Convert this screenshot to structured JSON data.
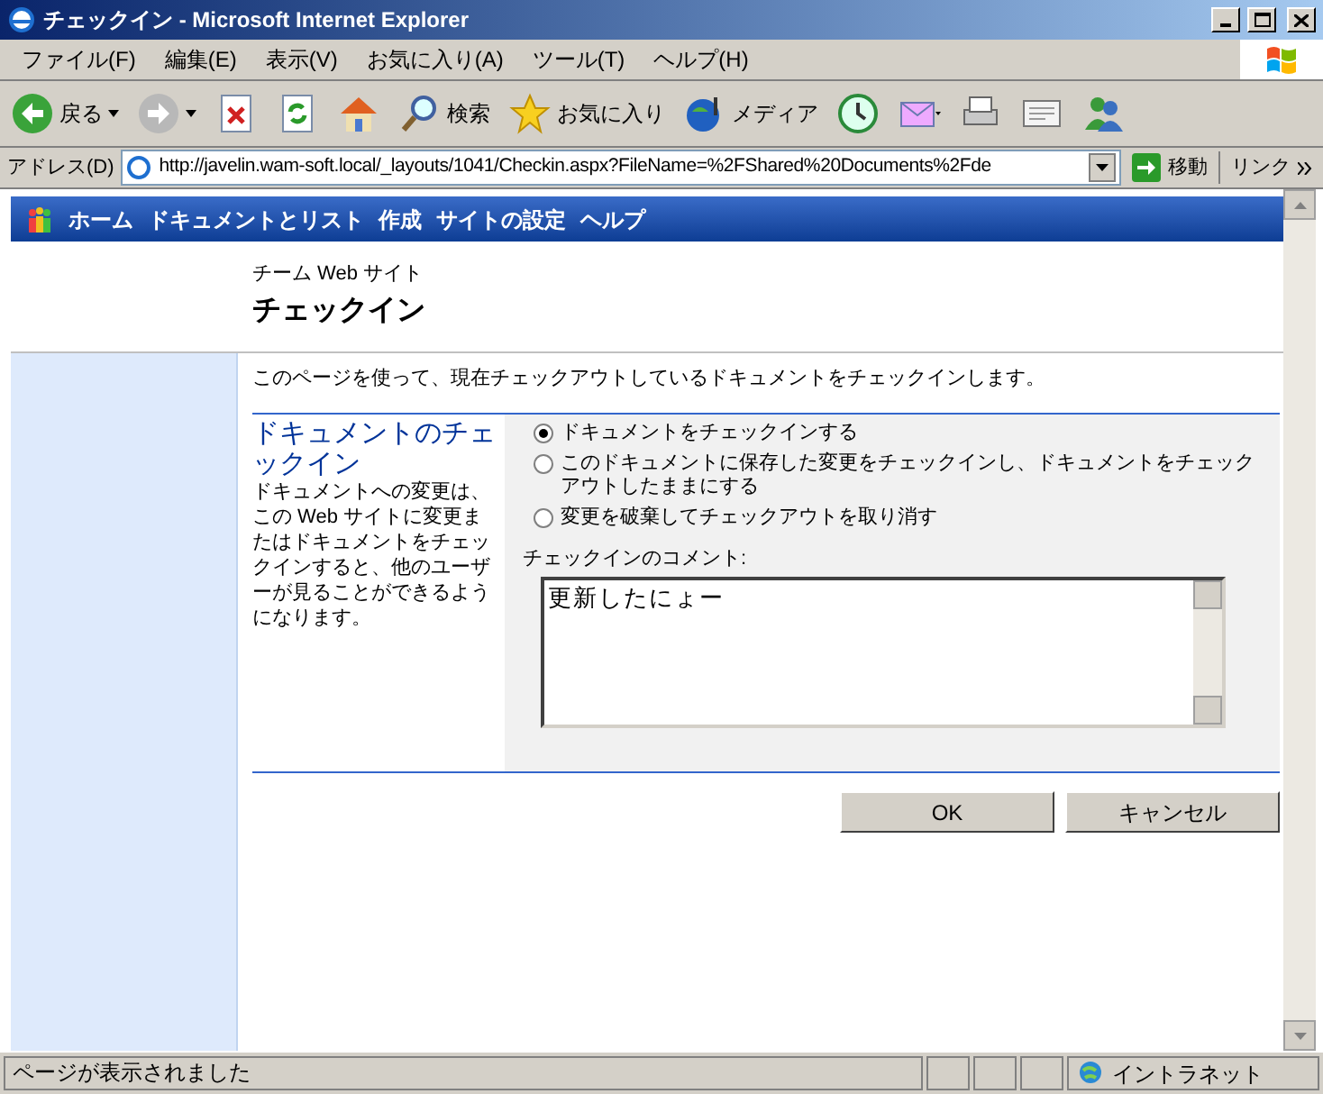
{
  "window": {
    "title": "チェックイン - Microsoft Internet Explorer"
  },
  "menu": [
    "ファイル(F)",
    "編集(E)",
    "表示(V)",
    "お気に入り(A)",
    "ツール(T)",
    "ヘルプ(H)"
  ],
  "toolbar": [
    {
      "kind": "back",
      "label": "戻る"
    },
    {
      "kind": "forward"
    },
    {
      "kind": "stop"
    },
    {
      "kind": "refresh"
    },
    {
      "kind": "home"
    },
    {
      "kind": "search",
      "label": "検索"
    },
    {
      "kind": "favorites",
      "label": "お気に入り"
    },
    {
      "kind": "media",
      "label": "メディア"
    },
    {
      "kind": "history"
    },
    {
      "kind": "mail"
    },
    {
      "kind": "print"
    },
    {
      "kind": "edit"
    },
    {
      "kind": "messenger"
    }
  ],
  "address": {
    "label": "アドレス(D)",
    "value": "http://javelin.wam-soft.local/_layouts/1041/Checkin.aspx?FileName=%2FShared%20Documents%2Fde",
    "go": "移動",
    "links": "リンク"
  },
  "site_nav": [
    "ホーム",
    "ドキュメントとリスト",
    "作成",
    "サイトの設定",
    "ヘルプ"
  ],
  "header": {
    "site": "チーム Web サイト",
    "title": "チェックイン"
  },
  "description": "このページを使って、現在チェックアウトしているドキュメントをチェックインします。",
  "section": {
    "title": "ドキュメントのチェックイン",
    "text": "ドキュメントへの変更は、この Web サイトに変更またはドキュメントをチェックインすると、他のユーザーが見ることができるようになります。"
  },
  "options": [
    {
      "label": "ドキュメントをチェックインする",
      "selected": true
    },
    {
      "label": "このドキュメントに保存した変更をチェックインし、ドキュメントをチェックアウトしたままにする",
      "selected": false
    },
    {
      "label": "変更を破棄してチェックアウトを取り消す",
      "selected": false
    }
  ],
  "comment": {
    "label": "チェックインのコメント:",
    "value": "更新したにょー"
  },
  "buttons": [
    "OK",
    "キャンセル"
  ],
  "status_bar": {
    "text": "ページが表示されました",
    "zone": "イントラネット"
  }
}
